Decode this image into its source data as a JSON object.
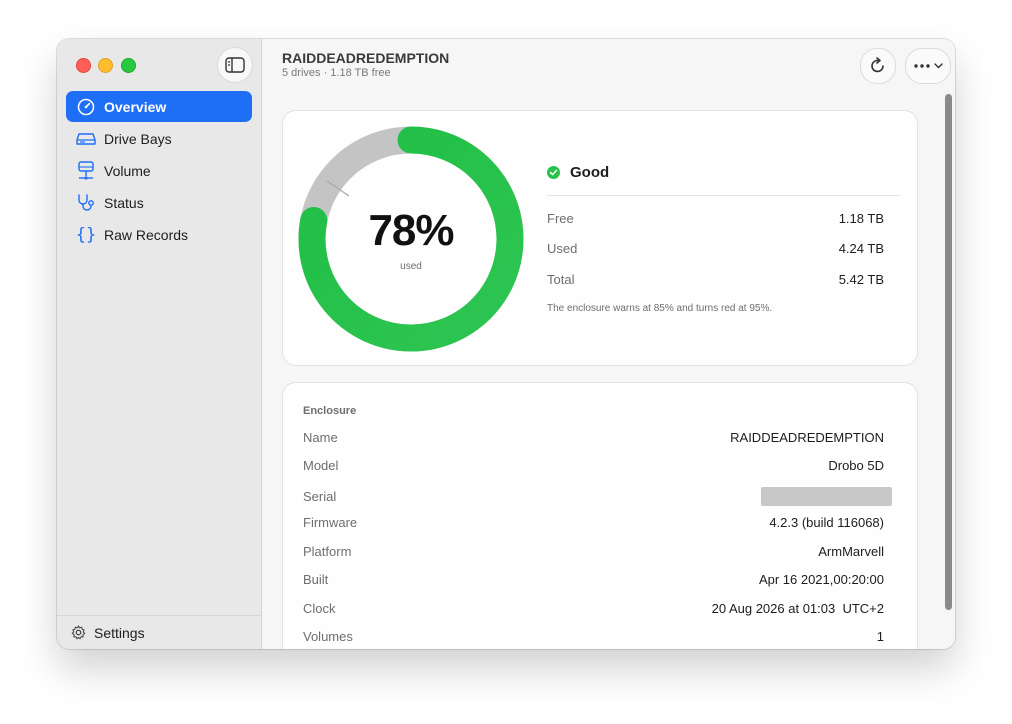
{
  "sidebar": {
    "items": [
      {
        "label": "Overview",
        "icon": "gauge-icon"
      },
      {
        "label": "Drive Bays",
        "icon": "drive-icon"
      },
      {
        "label": "Volume",
        "icon": "volume-icon"
      },
      {
        "label": "Status",
        "icon": "stethoscope-icon"
      },
      {
        "label": "Raw Records",
        "icon": "braces-icon"
      }
    ],
    "settings_label": "Settings"
  },
  "header": {
    "title": "RAIDDEADREDEMPTION",
    "subtitle": "5 drives · 1.18 TB free"
  },
  "usage": {
    "percent_text": "78%",
    "percent_value": 78,
    "used_caption": "used",
    "status_label": "Good",
    "rows": [
      {
        "label": "Free",
        "value": "1.18 TB"
      },
      {
        "label": "Used",
        "value": "4.24 TB"
      },
      {
        "label": "Total",
        "value": "5.42 TB"
      }
    ],
    "note": "The enclosure warns at 85% and turns red at 95%."
  },
  "enclosure": {
    "heading": "Enclosure",
    "rows": [
      {
        "label": "Name",
        "value": "RAIDDEADREDEMPTION"
      },
      {
        "label": "Model",
        "value": "Drobo 5D"
      },
      {
        "label": "Serial",
        "value": ""
      },
      {
        "label": "Firmware",
        "value": "4.2.3 (build 116068)"
      },
      {
        "label": "Platform",
        "value": "ArmMarvell"
      },
      {
        "label": "Built",
        "value": "Apr 16 2021,00:20:00"
      },
      {
        "label": "Clock",
        "value": "20 Aug 2026 at 01:03  UTC+2"
      },
      {
        "label": "Volumes",
        "value": "1"
      }
    ]
  },
  "colors": {
    "accent": "#1e6ff5",
    "good": "#27c24c",
    "donut_track": "#c4c4c4"
  }
}
